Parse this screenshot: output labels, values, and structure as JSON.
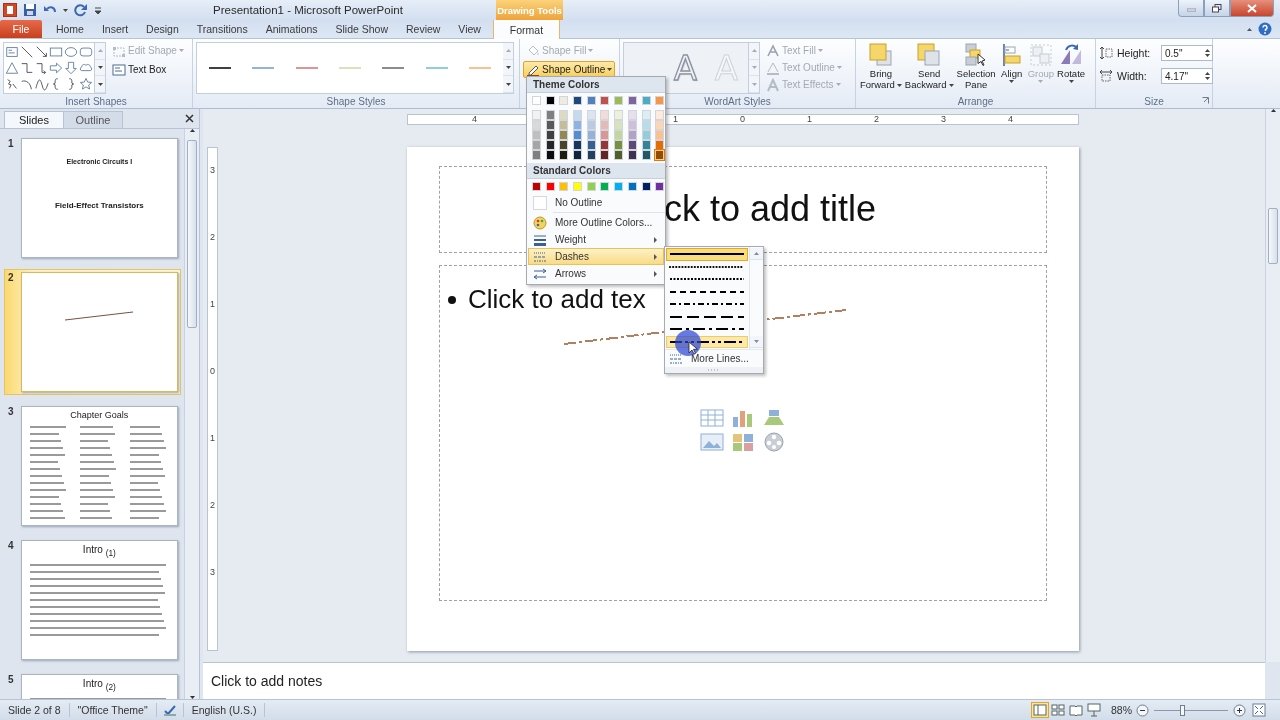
{
  "window": {
    "title": "Presentation1 - Microsoft PowerPoint",
    "contextual_group": "Drawing Tools"
  },
  "tabs": [
    {
      "label": "File",
      "kind": "file",
      "selected": false
    },
    {
      "label": "Home",
      "kind": "tab",
      "selected": false
    },
    {
      "label": "Insert",
      "kind": "tab",
      "selected": false
    },
    {
      "label": "Design",
      "kind": "tab",
      "selected": false
    },
    {
      "label": "Transitions",
      "kind": "tab",
      "selected": false
    },
    {
      "label": "Animations",
      "kind": "tab",
      "selected": false
    },
    {
      "label": "Slide Show",
      "kind": "tab",
      "selected": false
    },
    {
      "label": "Review",
      "kind": "tab",
      "selected": false
    },
    {
      "label": "View",
      "kind": "tab",
      "selected": false
    },
    {
      "label": "Format",
      "kind": "contextual",
      "selected": true
    }
  ],
  "ribbon": {
    "insert_shapes": {
      "label": "Insert Shapes",
      "commands": [
        {
          "label": "Edit Shape",
          "kind": "edit-shape",
          "disabled": true
        },
        {
          "label": "Text Box",
          "kind": "text-box",
          "disabled": false
        }
      ]
    },
    "shape_styles": {
      "label": "Shape Styles",
      "styles": [
        {
          "color": "#404040"
        },
        {
          "color": "#95b3d7"
        },
        {
          "color": "#d99694"
        },
        {
          "color": "#d7e3bc"
        },
        {
          "color": "#8c8c8c"
        },
        {
          "color": "#92cddc"
        },
        {
          "color": "#fac08f"
        }
      ]
    },
    "shape_format": [
      {
        "label": "Shape Fill",
        "kind": "fill",
        "disabled": true,
        "pressed": false
      },
      {
        "label": "Shape Outline",
        "kind": "outline",
        "disabled": false,
        "pressed": true
      }
    ],
    "wordart_styles": {
      "label": "WordArt Styles",
      "styles": [
        {
          "label": "A",
          "kind": "shadow"
        },
        {
          "label": "A",
          "kind": "faint"
        }
      ],
      "commands": [
        {
          "label": "Text Fill",
          "kind": "fill",
          "disabled": true
        },
        {
          "label": "Text Outline",
          "kind": "outline",
          "disabled": true
        },
        {
          "label": "Text Effects",
          "kind": "effects",
          "disabled": true
        }
      ]
    },
    "arrange": {
      "label": "Arrange",
      "commands": [
        {
          "lines": [
            "Bring",
            "Forward"
          ],
          "kind": "bring-forward",
          "has_menu": true,
          "disabled": false
        },
        {
          "lines": [
            "Send",
            "Backward"
          ],
          "kind": "send-backward",
          "has_menu": true,
          "disabled": false
        },
        {
          "lines": [
            "Selection",
            "Pane"
          ],
          "kind": "selection-pane",
          "has_menu": false,
          "disabled": false
        },
        {
          "lines": [
            "Align"
          ],
          "kind": "align",
          "has_menu": true,
          "disabled": false
        },
        {
          "lines": [
            "Group"
          ],
          "kind": "group",
          "has_menu": true,
          "disabled": true
        },
        {
          "lines": [
            "Rotate"
          ],
          "kind": "rotate",
          "has_menu": true,
          "disabled": false
        }
      ]
    },
    "size": {
      "label": "Size",
      "fields": [
        {
          "label": "Height:",
          "value": "0.5\"",
          "kind": "height"
        },
        {
          "label": "Width:",
          "value": "4.17\"",
          "kind": "width"
        }
      ]
    }
  },
  "slides_pane": {
    "tabs": [
      {
        "label": "Slides",
        "selected": true
      },
      {
        "label": "Outline",
        "selected": false
      }
    ],
    "thumbnails": [
      {
        "number": "1",
        "kind": "title",
        "selected": false,
        "title": "Electronic Circuits I",
        "subtitle": "Field-Effect Transistors"
      },
      {
        "number": "2",
        "kind": "line",
        "selected": true
      },
      {
        "number": "3",
        "kind": "columns",
        "selected": false,
        "title": "Chapter Goals"
      },
      {
        "number": "4",
        "kind": "bullets",
        "selected": false,
        "title": "Intro $_{(1)}$"
      },
      {
        "number": "5",
        "kind": "bullets",
        "selected": false,
        "title": "Intro $_{(2)}$"
      }
    ]
  },
  "ruler": {
    "horizontal_left": [
      {
        "label": "4"
      }
    ],
    "horizontal_right": [
      {
        "label": "1"
      },
      {
        "label": "0"
      },
      {
        "label": "1"
      },
      {
        "label": "2"
      },
      {
        "label": "3"
      },
      {
        "label": "4"
      }
    ],
    "vertical": [
      {
        "label": "3"
      },
      {
        "label": "2"
      },
      {
        "label": "1"
      },
      {
        "label": "0"
      },
      {
        "label": "1"
      },
      {
        "label": "2"
      },
      {
        "label": "3"
      }
    ]
  },
  "slide": {
    "title": "ck to add title",
    "bullets": [
      "Click to add tex"
    ],
    "shape": {
      "kind": "dash-dot-line",
      "color": "#b08060"
    }
  },
  "notes": {
    "text": "Click to add notes"
  },
  "outline_menu": {
    "theme_header": "Theme Colors",
    "theme_colors": [
      {
        "swatches": [
          {
            "color": "#ffffff",
            "selected": false
          },
          {
            "color": "#f2f2f2",
            "selected": false
          },
          {
            "color": "#d9d9d9",
            "selected": false
          },
          {
            "color": "#bfbfbf",
            "selected": false
          },
          {
            "color": "#a6a6a6",
            "selected": false
          },
          {
            "color": "#808080",
            "selected": false
          }
        ]
      },
      {
        "swatches": [
          {
            "color": "#000000",
            "selected": false
          },
          {
            "color": "#7f7f7f",
            "selected": false
          },
          {
            "color": "#595959",
            "selected": false
          },
          {
            "color": "#404040",
            "selected": false
          },
          {
            "color": "#262626",
            "selected": false
          },
          {
            "color": "#0d0d0d",
            "selected": false
          }
        ]
      },
      {
        "swatches": [
          {
            "color": "#eeece1",
            "selected": false
          },
          {
            "color": "#ddd9c3",
            "selected": false
          },
          {
            "color": "#c4bd97",
            "selected": false
          },
          {
            "color": "#938953",
            "selected": false
          },
          {
            "color": "#494429",
            "selected": false
          },
          {
            "color": "#1d1b10",
            "selected": false
          }
        ]
      },
      {
        "swatches": [
          {
            "color": "#1f497d",
            "selected": false
          },
          {
            "color": "#c6d9f0",
            "selected": false
          },
          {
            "color": "#8db3e2",
            "selected": false
          },
          {
            "color": "#548dd4",
            "selected": false
          },
          {
            "color": "#17365d",
            "selected": false
          },
          {
            "color": "#0f243e",
            "selected": false
          }
        ]
      },
      {
        "swatches": [
          {
            "color": "#4f81bd",
            "selected": false
          },
          {
            "color": "#dbe5f1",
            "selected": false
          },
          {
            "color": "#b8cce4",
            "selected": false
          },
          {
            "color": "#95b3d7",
            "selected": false
          },
          {
            "color": "#366092",
            "selected": false
          },
          {
            "color": "#244061",
            "selected": false
          }
        ]
      },
      {
        "swatches": [
          {
            "color": "#c0504d",
            "selected": false
          },
          {
            "color": "#f2dcdb",
            "selected": false
          },
          {
            "color": "#e5b9b7",
            "selected": false
          },
          {
            "color": "#d99694",
            "selected": false
          },
          {
            "color": "#953734",
            "selected": false
          },
          {
            "color": "#632423",
            "selected": false
          }
        ]
      },
      {
        "swatches": [
          {
            "color": "#9bbb59",
            "selected": false
          },
          {
            "color": "#ebf1dd",
            "selected": false
          },
          {
            "color": "#d7e3bc",
            "selected": false
          },
          {
            "color": "#c3d69b",
            "selected": false
          },
          {
            "color": "#76923c",
            "selected": false
          },
          {
            "color": "#4f6128",
            "selected": false
          }
        ]
      },
      {
        "swatches": [
          {
            "color": "#8064a2",
            "selected": false
          },
          {
            "color": "#e5e0ec",
            "selected": false
          },
          {
            "color": "#ccc1d9",
            "selected": false
          },
          {
            "color": "#b2a2c7",
            "selected": false
          },
          {
            "color": "#5f497a",
            "selected": false
          },
          {
            "color": "#3f3151",
            "selected": false
          }
        ]
      },
      {
        "swatches": [
          {
            "color": "#4bacc6",
            "selected": false
          },
          {
            "color": "#dbeef3",
            "selected": false
          },
          {
            "color": "#b7dde8",
            "selected": false
          },
          {
            "color": "#92cddc",
            "selected": false
          },
          {
            "color": "#31859b",
            "selected": false
          },
          {
            "color": "#205867",
            "selected": false
          }
        ]
      },
      {
        "swatches": [
          {
            "color": "#f79646",
            "selected": false
          },
          {
            "color": "#fdeada",
            "selected": false
          },
          {
            "color": "#fbd5b5",
            "selected": false
          },
          {
            "color": "#fac08f",
            "selected": false
          },
          {
            "color": "#e36c09",
            "selected": false
          },
          {
            "color": "#974806",
            "selected": true
          }
        ]
      }
    ],
    "standard_header": "Standard Colors",
    "standard_colors": [
      {
        "color": "#c00000",
        "selected": false
      },
      {
        "color": "#ff0000",
        "selected": false
      },
      {
        "color": "#ffc000",
        "selected": false
      },
      {
        "color": "#ffff00",
        "selected": false
      },
      {
        "color": "#92d050",
        "selected": false
      },
      {
        "color": "#00b050",
        "selected": false
      },
      {
        "color": "#00b0f0",
        "selected": false
      },
      {
        "color": "#0070c0",
        "selected": false
      },
      {
        "color": "#002060",
        "selected": false
      },
      {
        "color": "#7030a0",
        "selected": false
      }
    ],
    "items": [
      {
        "label": "No Outline",
        "kind": "none",
        "highlighted": false,
        "submenu": false
      },
      {
        "label": "More Outline Colors...",
        "kind": "colors",
        "highlighted": false,
        "submenu": false
      },
      {
        "label": "Weight",
        "kind": "weight",
        "highlighted": false,
        "submenu": true
      },
      {
        "label": "Dashes",
        "kind": "dashes",
        "highlighted": true,
        "submenu": true
      },
      {
        "label": "Arrows",
        "kind": "arrows",
        "highlighted": false,
        "submenu": true
      }
    ]
  },
  "dashes_menu": {
    "styles": [
      {
        "kind": "solid",
        "selected": true,
        "hovered": false
      },
      {
        "kind": "round-dot",
        "selected": false,
        "hovered": false
      },
      {
        "kind": "square-dot",
        "selected": false,
        "hovered": false
      },
      {
        "kind": "dash",
        "selected": false,
        "hovered": false
      },
      {
        "kind": "dash-dot",
        "selected": false,
        "hovered": false
      },
      {
        "kind": "long-dash",
        "selected": false,
        "hovered": false
      },
      {
        "kind": "long-dash-dot",
        "selected": false,
        "hovered": false
      },
      {
        "kind": "long-dash-dot-dot",
        "selected": false,
        "hovered": true
      }
    ],
    "more": "More Lines..."
  },
  "status_bar": {
    "slide": "Slide 2 of 8",
    "theme": "\"Office Theme\"",
    "language": "English (U.S.)",
    "views": [
      {
        "kind": "normal",
        "selected": true
      },
      {
        "kind": "sorter",
        "selected": false
      },
      {
        "kind": "reading",
        "selected": false
      },
      {
        "kind": "slideshow",
        "selected": false
      }
    ],
    "zoom": "88%",
    "zoom_slider": {
      "level": 0.38
    }
  }
}
